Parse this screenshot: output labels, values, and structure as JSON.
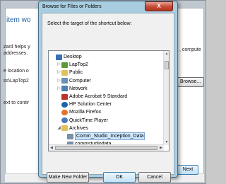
{
  "background_wizard": {
    "title": "item wo",
    "lines": [
      "zard helps y",
      "addresses.",
      "e location o",
      "ss\\LapTop2",
      "ext to contir"
    ],
    "right_fragment": ", compute",
    "browse_label": "Browse...",
    "next_label": "Next"
  },
  "dialog": {
    "title": "Browse for Files or Folders",
    "close_label": "X",
    "prompt": "Select the target of the shortcut below:",
    "tree": [
      {
        "label": "Desktop",
        "icon": "desktop-icon",
        "expander": "",
        "level": 0,
        "color": "#3a6fb7"
      },
      {
        "label": "LapTop2",
        "icon": "user-folder-icon",
        "expander": "▷",
        "level": 1,
        "color": "#5a9a3a"
      },
      {
        "label": "Public",
        "icon": "folder-icon",
        "expander": "▷",
        "level": 1,
        "color": "#e1c25a"
      },
      {
        "label": "Computer",
        "icon": "computer-icon",
        "expander": "▷",
        "level": 1,
        "color": "#6d8fb3"
      },
      {
        "label": "Network",
        "icon": "network-icon",
        "expander": "▷",
        "level": 1,
        "color": "#4f7fb0"
      },
      {
        "label": "Adobe Acrobat 9 Standard",
        "icon": "acrobat-icon",
        "expander": "",
        "level": 1,
        "color": "#c0332b"
      },
      {
        "label": "HP Solution Center",
        "icon": "hp-icon",
        "expander": "",
        "level": 1,
        "color": "#1e63a8"
      },
      {
        "label": "Mozilla Firefox",
        "icon": "firefox-icon",
        "expander": "",
        "level": 1,
        "color": "#e2732a"
      },
      {
        "label": "QuickTime Player",
        "icon": "quicktime-icon",
        "expander": "",
        "level": 1,
        "color": "#4a79b5"
      },
      {
        "label": "Archives",
        "icon": "folder-icon",
        "expander": "◢",
        "level": 1,
        "color": "#e1c25a"
      },
      {
        "label": "Comm_Studio_Inception_Data",
        "icon": "file-icon",
        "expander": "",
        "level": 2,
        "color": "#7a8fa8",
        "selected": true
      },
      {
        "label": "commstudiodata",
        "icon": "file-icon",
        "expander": "",
        "level": 2,
        "color": "#7a8fa8"
      }
    ],
    "make_new_folder_label": "Make New Folder",
    "ok_label": "OK",
    "cancel_label": "Cancel"
  }
}
